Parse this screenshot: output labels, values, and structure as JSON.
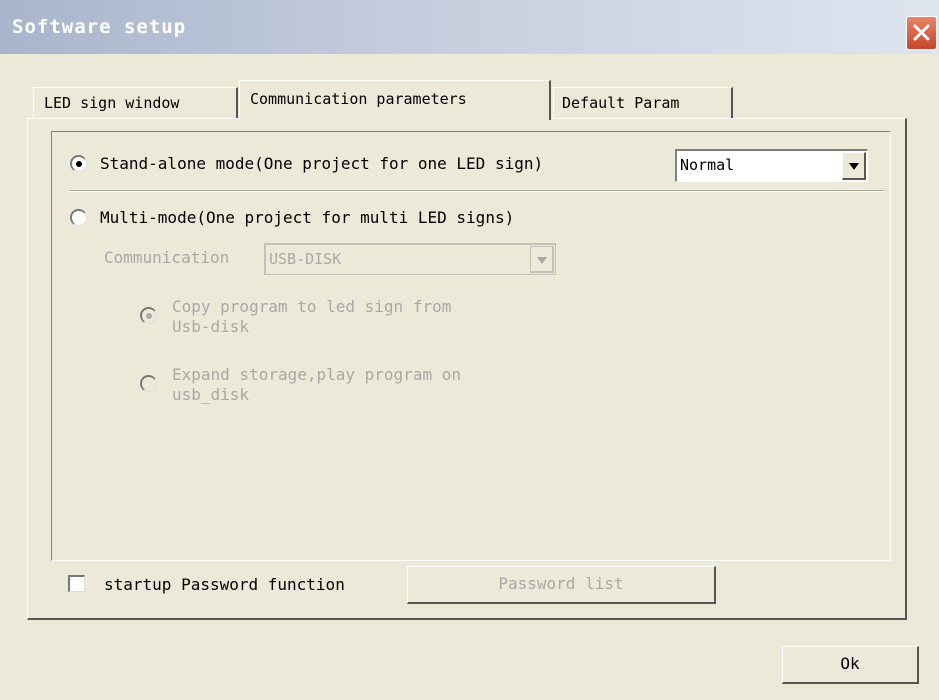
{
  "window": {
    "title": "Software setup",
    "close_icon": "close-x-icon",
    "accent_color": "#d9532f"
  },
  "tabs": [
    {
      "label": "LED sign window",
      "active": false
    },
    {
      "label": "Communication parameters",
      "active": true
    },
    {
      "label": "Default Param",
      "active": false
    }
  ],
  "mode": {
    "standalone_label": "Stand-alone mode(One project for one LED sign)",
    "standalone_checked": true,
    "standalone_select_value": "Normal",
    "multi_label": "Multi-mode(One project for multi LED signs)",
    "multi_checked": false
  },
  "communication": {
    "label": "Communication",
    "value": "USB-DISK",
    "option_copy_line1": "Copy program to led sign from",
    "option_copy_line2": "Usb-disk",
    "option_expand_line1": "Expand storage,play program on",
    "option_expand_line2": "usb_disk"
  },
  "password": {
    "checkbox_label": "startup Password function",
    "checked": false,
    "list_button": "Password list"
  },
  "footer": {
    "ok_button": "Ok"
  }
}
